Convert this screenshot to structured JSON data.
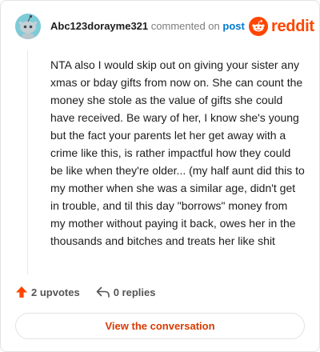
{
  "header": {
    "username": "Abc123dorayme321",
    "action_text": "commented on",
    "post_link": "post",
    "brand": "reddit"
  },
  "comment": {
    "body": "NTA also I would skip out on giving your sister any xmas or bday gifts from now on. She can count the money she stole as the value of gifts she could have received. Be wary of her, I know she's young but the fact your parents let her get away with a crime like this, is rather impactful how they could be like when they're older... (my half aunt did this to my mother when she was a similar age, didn't get in trouble, and til this day \"borrows\" money from my mother without paying it back, owes her in the thousands and bitches and treats her like shit"
  },
  "actions": {
    "upvotes": "2 upvotes",
    "replies": "0 replies"
  },
  "footer": {
    "view_conversation": "View the conversation"
  },
  "colors": {
    "brand": "#ff4500",
    "link": "#0079d3",
    "cta": "#d93a00",
    "avatar": "#7ecbd8"
  },
  "icons": [
    "reddit-alien-icon",
    "reddit-logo-icon",
    "upvote-arrow-icon",
    "reply-icon"
  ]
}
